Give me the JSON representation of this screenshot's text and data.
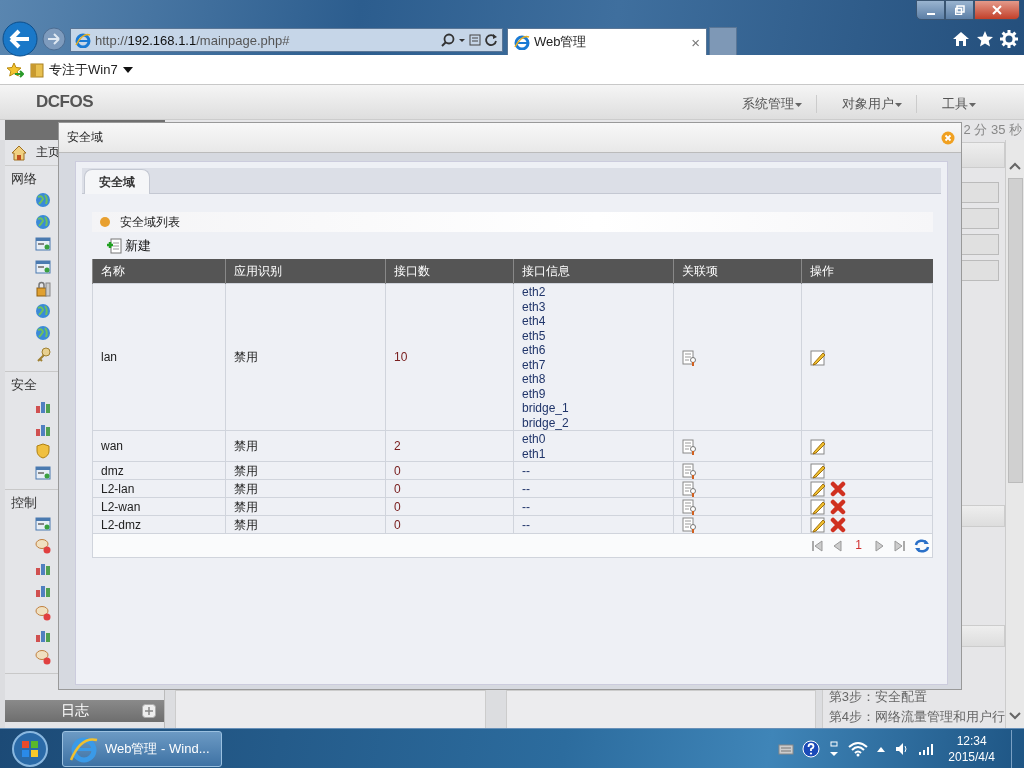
{
  "browser": {
    "url_scheme": "http://",
    "url_host": "192.168.1.1",
    "url_path": "/mainpage.php#",
    "tab": {
      "title": "Web管理",
      "close": "×"
    },
    "favorites": {
      "folder": "专注于Win7"
    }
  },
  "header": {
    "logo": "DCFOS",
    "menus": [
      {
        "label": "系统管理"
      },
      {
        "label": "对象用户"
      },
      {
        "label": "工具"
      }
    ],
    "timer": "2 分 35 秒"
  },
  "sidebar": {
    "home": "主页",
    "sections": [
      {
        "title": "网络"
      },
      {
        "title": "安全"
      },
      {
        "title": "控制"
      }
    ],
    "bottom": [
      {
        "label": "日志"
      }
    ]
  },
  "steps": [
    "第3步：安全配置",
    "第4步：网络流量管理和用户行"
  ],
  "dialog": {
    "title": "安全域",
    "tabs": [
      {
        "label": "安全域",
        "selected": true
      }
    ],
    "section_title": "安全域列表",
    "new_button": "新建",
    "table": {
      "columns": [
        "名称",
        "应用识别",
        "接口数",
        "接口信息",
        "关联项",
        "操作"
      ],
      "rows": [
        {
          "name": "lan",
          "app_id": "禁用",
          "interface_count": "10",
          "interfaces": [
            "eth2",
            "eth3",
            "eth4",
            "eth5",
            "eth6",
            "eth7",
            "eth8",
            "eth9",
            "bridge_1",
            "bridge_2"
          ],
          "deletable": false
        },
        {
          "name": "wan",
          "app_id": "禁用",
          "interface_count": "2",
          "interfaces": [
            "eth0",
            "eth1"
          ],
          "deletable": false
        },
        {
          "name": "dmz",
          "app_id": "禁用",
          "interface_count": "0",
          "interfaces": [
            "--"
          ],
          "deletable": false
        },
        {
          "name": "L2-lan",
          "app_id": "禁用",
          "interface_count": "0",
          "interfaces": [
            "--"
          ],
          "deletable": true
        },
        {
          "name": "L2-wan",
          "app_id": "禁用",
          "interface_count": "0",
          "interfaces": [
            "--"
          ],
          "deletable": true
        },
        {
          "name": "L2-dmz",
          "app_id": "禁用",
          "interface_count": "0",
          "interfaces": [
            "--"
          ],
          "deletable": true
        }
      ]
    },
    "pager": {
      "page": "1"
    }
  },
  "taskbar": {
    "app": "Web管理 - Wind...",
    "time": "12:34",
    "date": "2015/4/4"
  }
}
